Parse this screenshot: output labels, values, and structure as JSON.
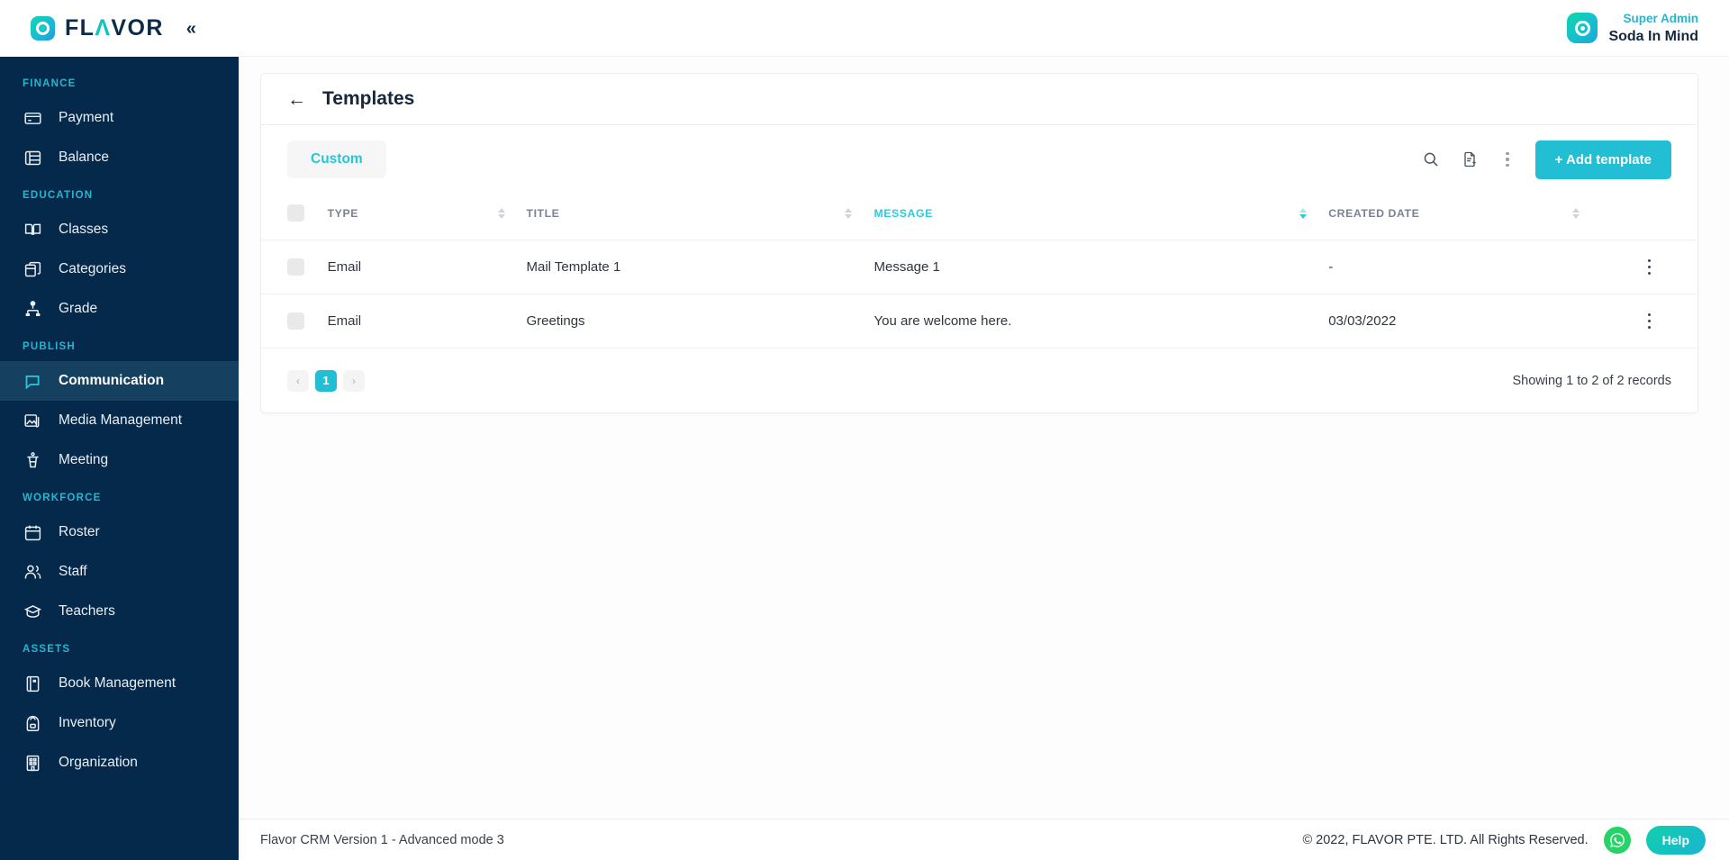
{
  "brand": {
    "logo_text_1": "FL",
    "logo_text_a": "Λ",
    "logo_text_2": "VOR",
    "collapse_icon": "chevron-double-left-icon"
  },
  "user": {
    "role": "Super Admin",
    "name": "Soda In Mind"
  },
  "sidebar": {
    "groups": [
      {
        "label": "FINANCE",
        "items": [
          {
            "label": "Payment",
            "icon": "credit-card-icon",
            "active": false
          },
          {
            "label": "Balance",
            "icon": "stacked-database-icon",
            "active": false
          }
        ]
      },
      {
        "label": "EDUCATION",
        "items": [
          {
            "label": "Classes",
            "icon": "open-book-icon",
            "active": false
          },
          {
            "label": "Categories",
            "icon": "layered-box-icon",
            "active": false
          },
          {
            "label": "Grade",
            "icon": "hierarchy-icon",
            "active": false
          }
        ]
      },
      {
        "label": "PUBLISH",
        "items": [
          {
            "label": "Communication",
            "icon": "chat-bubble-icon",
            "active": true
          },
          {
            "label": "Media Management",
            "icon": "image-stack-icon",
            "active": false
          },
          {
            "label": "Meeting",
            "icon": "podium-icon",
            "active": false
          }
        ]
      },
      {
        "label": "WORKFORCE",
        "items": [
          {
            "label": "Roster",
            "icon": "calendar-icon",
            "active": false
          },
          {
            "label": "Staff",
            "icon": "users-icon",
            "active": false
          },
          {
            "label": "Teachers",
            "icon": "graduation-cap-icon",
            "active": false
          }
        ]
      },
      {
        "label": "ASSETS",
        "items": [
          {
            "label": "Book Management",
            "icon": "book-icon",
            "active": false
          },
          {
            "label": "Inventory",
            "icon": "backpack-icon",
            "active": false
          },
          {
            "label": "Organization",
            "icon": "building-icon",
            "active": false
          }
        ]
      }
    ]
  },
  "page": {
    "title": "Templates",
    "back_icon": "arrow-left-icon"
  },
  "toolbar": {
    "tab_label": "Custom",
    "search_icon": "search-icon",
    "export_icon": "file-add-icon",
    "more_icon": "dots-vertical-icon",
    "add_button_label": "+ Add template"
  },
  "table": {
    "columns": [
      {
        "label": "TYPE",
        "sortable": true,
        "active": false
      },
      {
        "label": "TITLE",
        "sortable": true,
        "active": false
      },
      {
        "label": "MESSAGE",
        "sortable": true,
        "active": true
      },
      {
        "label": "CREATED DATE",
        "sortable": true,
        "active": false
      }
    ],
    "rows": [
      {
        "type": "Email",
        "title": "Mail Template 1",
        "message": "Message 1",
        "created_date": "-"
      },
      {
        "type": "Email",
        "title": "Greetings",
        "message": "You are welcome here.",
        "created_date": "03/03/2022"
      }
    ]
  },
  "pagination": {
    "prev": "‹",
    "current_page": "1",
    "next": "›",
    "records_text": "Showing 1 to 2 of 2 records"
  },
  "footer": {
    "version_text": "Flavor CRM Version 1 - Advanced mode 3",
    "copyright": "© 2022, FLAVOR PTE. LTD. All Rights Reserved.",
    "whatsapp_icon": "whatsapp-icon",
    "help_label": "Help"
  },
  "colors": {
    "sidebar_bg": "#05294a",
    "accent_teal": "#22bed3",
    "group_label": "#26b6cf",
    "primary_button": "#22bed3",
    "annotation_arrow": "#ff0000",
    "whatsapp_green": "#25d366"
  },
  "annotation": {
    "type": "arrow",
    "points_to": "add-template-button"
  }
}
